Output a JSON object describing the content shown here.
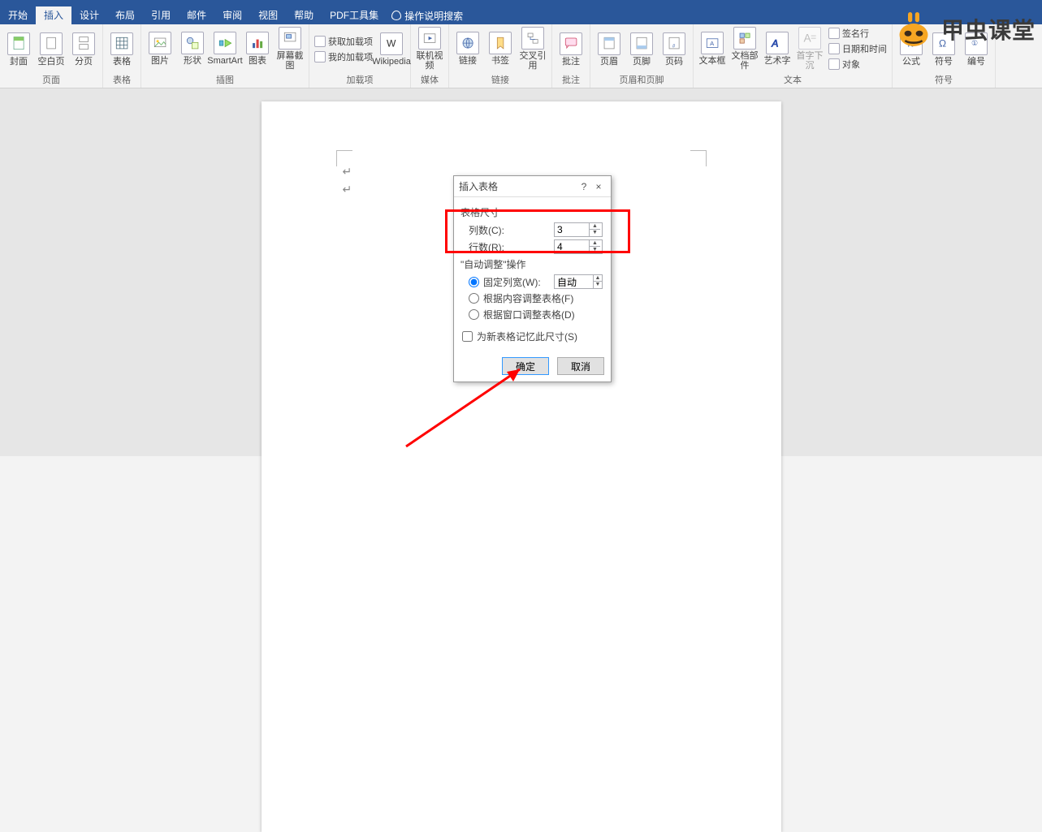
{
  "tabs": {
    "start": "开始",
    "insert": "插入",
    "design": "设计",
    "layout": "布局",
    "reference": "引用",
    "mail": "邮件",
    "review": "审阅",
    "view": "视图",
    "help": "帮助",
    "pdf": "PDF工具集"
  },
  "tellme": "操作说明搜索",
  "ribbon": {
    "cover": "封面",
    "blank": "空白页",
    "pagebreak": "分页",
    "g_page": "页面",
    "table": "表格",
    "g_table": "表格",
    "picture": "图片",
    "shape": "形状",
    "smartart": "SmartArt",
    "chart": "图表",
    "screenshot": "屏幕截图",
    "g_illus": "插图",
    "getaddins": "获取加载项",
    "myaddins": "我的加载项",
    "wikipedia": "Wikipedia",
    "g_addins": "加载项",
    "video": "联机视频",
    "g_media": "媒体",
    "link": "链接",
    "bookmark": "书签",
    "crossref": "交叉引用",
    "g_links": "链接",
    "comment": "批注",
    "g_comment": "批注",
    "header": "页眉",
    "footer": "页脚",
    "pagenum": "页码",
    "g_hf": "页眉和页脚",
    "textbox": "文本框",
    "quickparts": "文档部件",
    "wordart": "艺术字",
    "dropcap": "首字下沉",
    "sigline": "签名行",
    "datetime": "日期和时间",
    "object": "对象",
    "g_text": "文本",
    "equation": "公式",
    "symbol": "符号",
    "number": "编号",
    "g_sym": "符号"
  },
  "dialog": {
    "title": "插入表格",
    "help": "?",
    "close": "×",
    "size_label": "表格尺寸",
    "cols_label": "列数(C):",
    "cols_value": "3",
    "rows_label": "行数(R):",
    "rows_value": "4",
    "auto_label": "\"自动调整\"操作",
    "fixed": "固定列宽(W):",
    "fixed_value": "自动",
    "fit_content": "根据内容调整表格(F)",
    "fit_window": "根据窗口调整表格(D)",
    "remember": "为新表格记忆此尺寸(S)",
    "ok": "确定",
    "cancel": "取消"
  },
  "watermark": "甲虫课堂"
}
